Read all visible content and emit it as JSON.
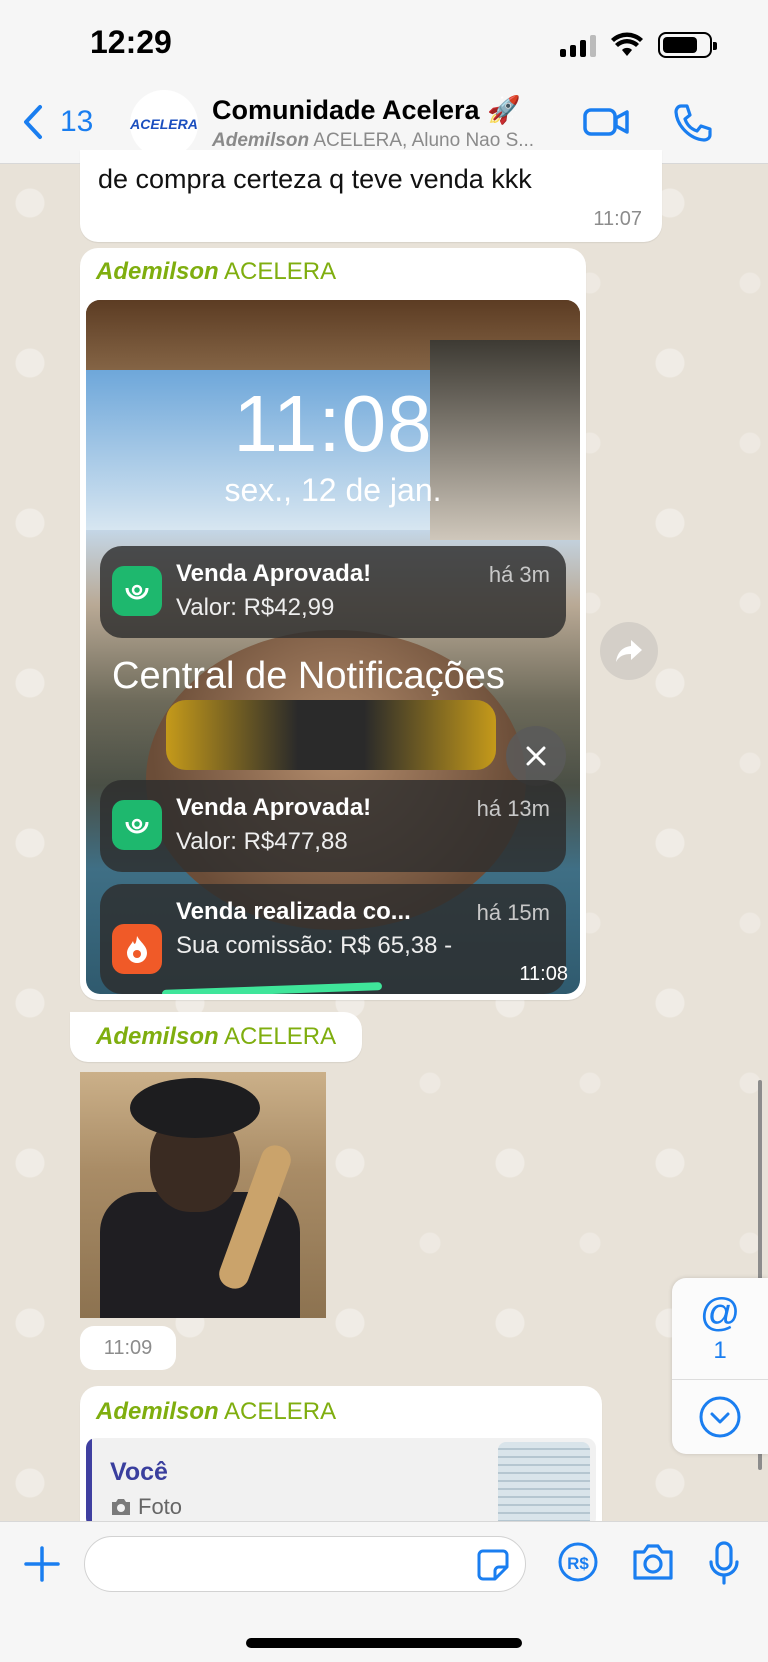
{
  "status_bar": {
    "time": "12:29"
  },
  "header": {
    "back_count": "13",
    "avatar_text": "ACELERA",
    "title": "Comunidade Acelera 🚀",
    "subtitle_name": "Ademilson",
    "subtitle_rest": " ACELERA, Aluno Nao S..."
  },
  "messages": {
    "m1": {
      "text": "de compra certeza q teve venda kkk",
      "time": "11:07"
    },
    "m2": {
      "sender_name": "Ademilson",
      "sender_tag": " ACELERA",
      "screenshot": {
        "clock": "11:08",
        "date": "sex., 12 de jan.",
        "central_label": "Central de Notificações",
        "notifications": [
          {
            "title": "Venda Aprovada!",
            "body": "Valor: R$42,99",
            "ago": "há 3m"
          },
          {
            "title": "Venda Aprovada!",
            "body": "Valor: R$477,88",
            "ago": "há 13m"
          },
          {
            "title": "Venda realizada co...",
            "body": "Sua comissão: R$ 65,38 -",
            "ago": "há 15m"
          }
        ]
      },
      "time": "11:08"
    },
    "m3": {
      "sender_name": "Ademilson",
      "sender_tag": " ACELERA",
      "time": "11:09"
    },
    "m4": {
      "sender_name": "Ademilson",
      "sender_tag": " ACELERA",
      "quote_name": "Você",
      "quote_body": "Foto"
    }
  },
  "side_panel": {
    "mention_symbol": "@",
    "mention_count": "1"
  },
  "colors": {
    "accent": "#1a7ef0",
    "sender": "#7fae0f",
    "notif_green": "#1eb86e",
    "notif_orange": "#f05a28"
  }
}
